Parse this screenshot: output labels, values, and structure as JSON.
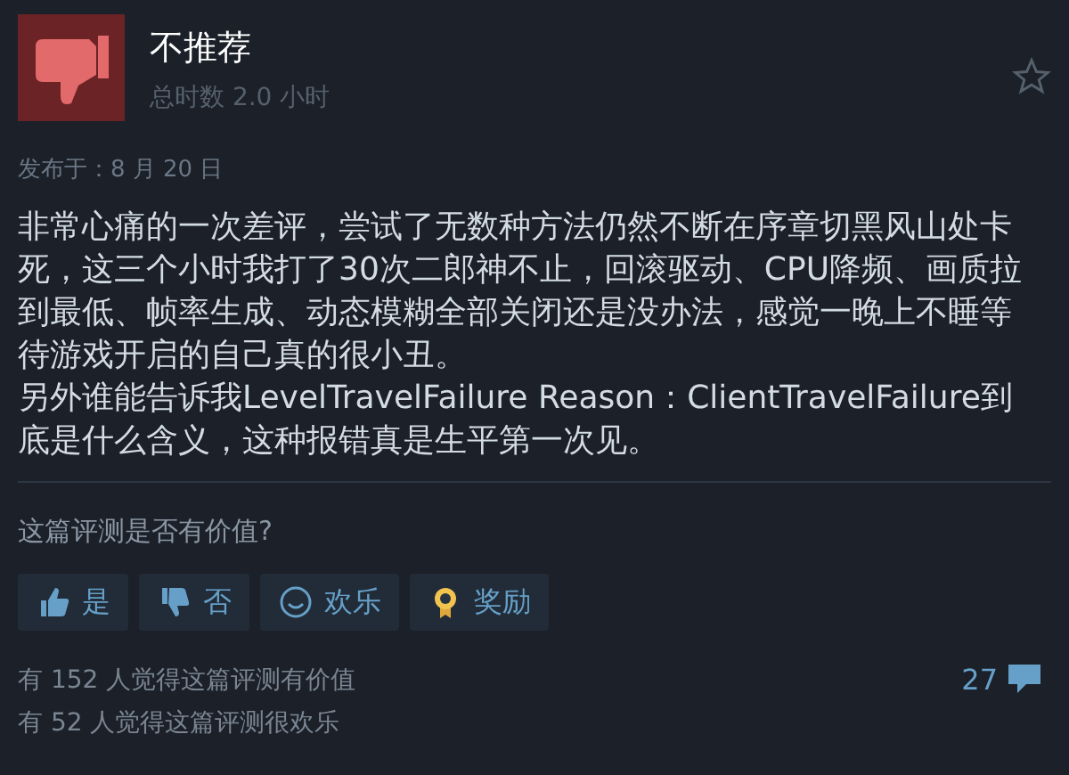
{
  "review": {
    "verdict": "不推荐",
    "playtime": "总时数 2.0 小时",
    "posted": "发布于：8 月 20 日"
  },
  "body": [
    "非常心痛的一次差评，尝试了无数种方法仍然不断在序章切黑风山处卡死，这三个小时我打了30次二郎神不止，回滚驱动、CPU降频、画质拉到最低、帧率生成、动态模糊全部关闭还是没办法，感觉一晚上不睡等待游戏开启的自己真的很小丑。",
    "另外谁能告诉我LevelTravelFailure Reason：ClientTravelFailure到底是什么含义，这种报错真是生平第一次见。"
  ],
  "question": "这篇评测是否有价值?",
  "buttons": [
    {
      "kind": "yes",
      "label": "是"
    },
    {
      "kind": "no",
      "label": "否"
    },
    {
      "kind": "funny",
      "label": "欢乐"
    },
    {
      "kind": "award",
      "label": "奖励"
    }
  ],
  "stats": [
    "有 152 人觉得这篇评测有价值",
    "有 52 人觉得这篇评测很欢乐"
  ],
  "comments": "27"
}
